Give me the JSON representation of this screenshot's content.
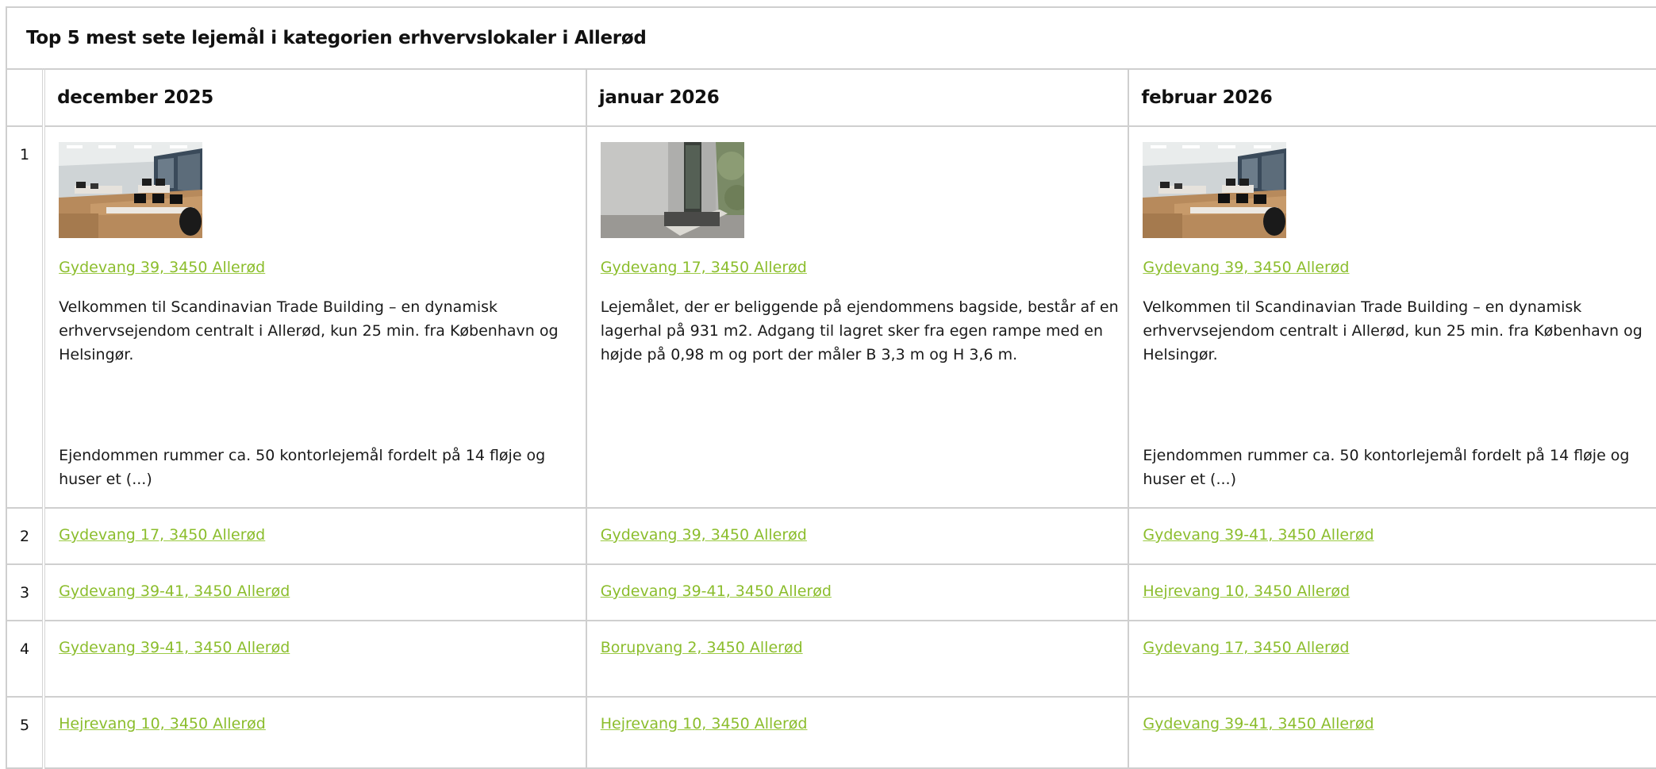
{
  "title": "Top 5 mest sete lejemål i kategorien erhvervslokaler i Allerød",
  "months": [
    "december 2025",
    "januar 2026",
    "februar 2026"
  ],
  "rank1": [
    {
      "image": "office-interior-photo",
      "address": "Gydevang 39, 3450 Allerød",
      "desc1": "Velkommen til Scandinavian Trade Building – en dynamisk erhvervsejendom centralt i Allerød, kun 25 min. fra København og Helsingør.",
      "desc2": "Ejendommen rummer ca. 50 kontorlejemål fordelt på 14 fløje og huser et (...)"
    },
    {
      "image": "warehouse-ramp-photo",
      "address": "Gydevang 17, 3450 Allerød",
      "desc1": "Lejemålet, der er beliggende på ejendommens bagside, består af en lagerhal på 931 m2. Adgang til lagret sker fra egen rampe med en højde på 0,98 m og port der måler B 3,3 m og H 3,6 m.",
      "desc2": ""
    },
    {
      "image": "office-interior-photo",
      "address": "Gydevang 39, 3450 Allerød",
      "desc1": "Velkommen til Scandinavian Trade Building – en dynamisk erhvervsejendom centralt i Allerød, kun 25 min. fra København og Helsingør.",
      "desc2": "Ejendommen rummer ca. 50 kontorlejemål fordelt på 14 fløje og huser et (...)"
    }
  ],
  "rows": [
    {
      "rank": "2",
      "addresses": [
        "Gydevang 17, 3450 Allerød",
        "Gydevang 39, 3450 Allerød",
        "Gydevang 39-41, 3450 Allerød"
      ]
    },
    {
      "rank": "3",
      "addresses": [
        "Gydevang 39-41, 3450 Allerød",
        "Gydevang 39-41, 3450 Allerød",
        "Hejrevang 10, 3450 Allerød"
      ]
    },
    {
      "rank": "4",
      "addresses": [
        "Gydevang 39-41, 3450 Allerød",
        "Borupvang 2, 3450 Allerød",
        "Gydevang 17, 3450 Allerød"
      ]
    },
    {
      "rank": "5",
      "addresses": [
        "Hejrevang 10, 3450 Allerød",
        "Hejrevang 10, 3450 Allerød",
        "Gydevang 39-41, 3450 Allerød"
      ]
    }
  ],
  "colors": {
    "link": "#8bbd2c",
    "border": "#cfcfcf"
  }
}
